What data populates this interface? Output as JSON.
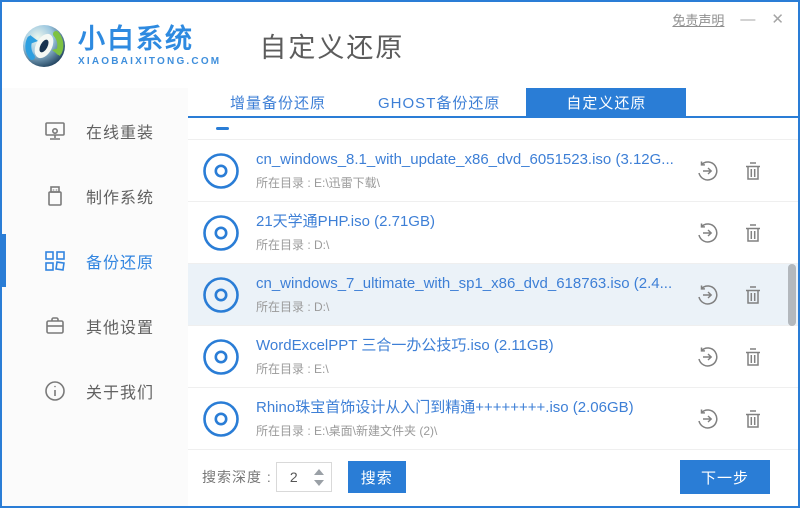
{
  "window": {
    "disclaimer_link": "免责声明",
    "minimize_glyph": "—",
    "close_glyph": "✕"
  },
  "brand": {
    "name": "小白系统",
    "domain": "XIAOBAIXITONG.COM"
  },
  "page": {
    "title": "自定义还原"
  },
  "sidebar": {
    "items": [
      {
        "label": "在线重装"
      },
      {
        "label": "制作系统"
      },
      {
        "label": "备份还原"
      },
      {
        "label": "其他设置"
      },
      {
        "label": "关于我们"
      }
    ]
  },
  "tabs": [
    {
      "label": "增量备份还原"
    },
    {
      "label": "GHOST备份还原"
    },
    {
      "label": "自定义还原"
    }
  ],
  "list": {
    "rows": [
      {
        "title": "cn_windows_8.1_with_update_x86_dvd_6051523.iso (3.12G...",
        "path": "所在目录 : E:\\迅雷下载\\"
      },
      {
        "title": "21天学通PHP.iso (2.71GB)",
        "path": "所在目录 : D:\\"
      },
      {
        "title": "cn_windows_7_ultimate_with_sp1_x86_dvd_618763.iso (2.4...",
        "path": "所在目录 : D:\\"
      },
      {
        "title": "WordExcelPPT 三合一办公技巧.iso (2.11GB)",
        "path": "所在目录 : E:\\"
      },
      {
        "title": "Rhino珠宝首饰设计从入门到精通++++++++.iso (2.06GB)",
        "path": "所在目录 : E:\\桌面\\新建文件夹 (2)\\"
      }
    ]
  },
  "footer": {
    "depth_label": "搜索深度 :",
    "depth_value": "2",
    "search_button": "搜索",
    "next_button": "下一步"
  },
  "colors": {
    "primary_blue": "#2a7dd6",
    "link_blue": "#3d7fd6",
    "selected_row_bg": "#ebf2f8",
    "sidebar_bg": "#fbfbfb"
  }
}
